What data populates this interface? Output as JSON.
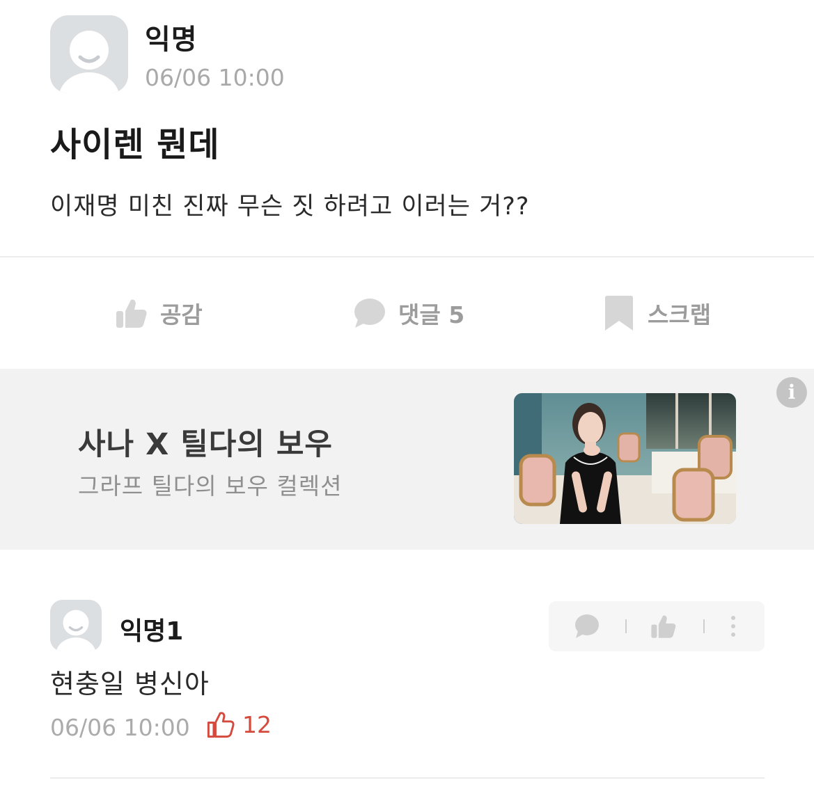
{
  "post": {
    "author": "익명",
    "time": "06/06 10:00",
    "title": "사이렌 뭔데",
    "body": "이재명 미친 진짜 무슨 짓 하려고 이러는 거??"
  },
  "actions": {
    "like_label": "공감",
    "comment_label": "댓글 5",
    "scrap_label": "스크랩"
  },
  "ad": {
    "title": "사나 X 틸다의 보우",
    "subtitle": "그라프 틸다의 보우 컬렉션",
    "info_icon": "i"
  },
  "comment": {
    "author": "익명1",
    "text": "현충일 병신아",
    "time": "06/06 10:00",
    "likes": "12"
  },
  "colors": {
    "like_accent": "#d44a3d",
    "muted_text": "#a9a9a9",
    "ad_background": "#f2f2f2"
  }
}
